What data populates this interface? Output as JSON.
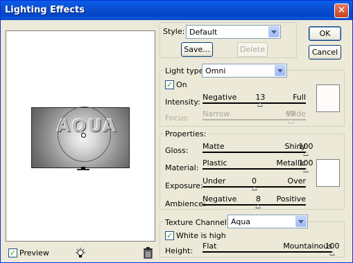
{
  "window": {
    "title": "Lighting Effects",
    "close_glyph": "✕"
  },
  "preview": {
    "canvas_text": "AQUA",
    "preview_label": "Preview",
    "preview_checked": true,
    "check_glyph": "✓",
    "light_icon": "light-bulb-icon",
    "trash_icon": "trash-icon"
  },
  "style": {
    "label": "Style:",
    "value": "Default",
    "save_label": "Save...",
    "delete_label": "Delete"
  },
  "buttons": {
    "ok": "OK",
    "cancel": "Cancel"
  },
  "light": {
    "type_label": "Light type:",
    "type_value": "Omni",
    "on_label": "On",
    "on_checked": true,
    "intensity": {
      "label": "Intensity:",
      "min": "Negative",
      "value": "13",
      "max": "Full",
      "position": 0.56
    },
    "focus": {
      "label": "Focus:",
      "min": "Narrow",
      "value": "69",
      "max": "Wide",
      "position": 0.85,
      "disabled": true
    },
    "swatch_color": "#fffbfb"
  },
  "properties": {
    "group_label": "Properties:",
    "gloss": {
      "label": "Gloss:",
      "min": "Matte",
      "value": "100",
      "max": "Shiny",
      "position": 1.0
    },
    "material": {
      "label": "Material:",
      "min": "Plastic",
      "value": "100",
      "max": "Metallic",
      "position": 1.0
    },
    "exposure": {
      "label": "Exposure:",
      "min": "Under",
      "value": "0",
      "max": "Over",
      "position": 0.5
    },
    "ambience": {
      "label": "Ambience:",
      "min": "Negative",
      "value": "8",
      "max": "Positive",
      "position": 0.54
    },
    "swatch_color": "#ffffff"
  },
  "texture": {
    "channel_label": "Texture Channel:",
    "channel_value": "Aqua",
    "white_high_label": "White is high",
    "white_high_checked": true,
    "height": {
      "label": "Height:",
      "min": "Flat",
      "value": "100",
      "max": "Mountainous",
      "position": 1.0
    }
  },
  "colors": {
    "title_bar": "#0a4ed0",
    "dialog_bg": "#ece9d8",
    "check": "#21a121",
    "close_button": "#d0562f"
  }
}
